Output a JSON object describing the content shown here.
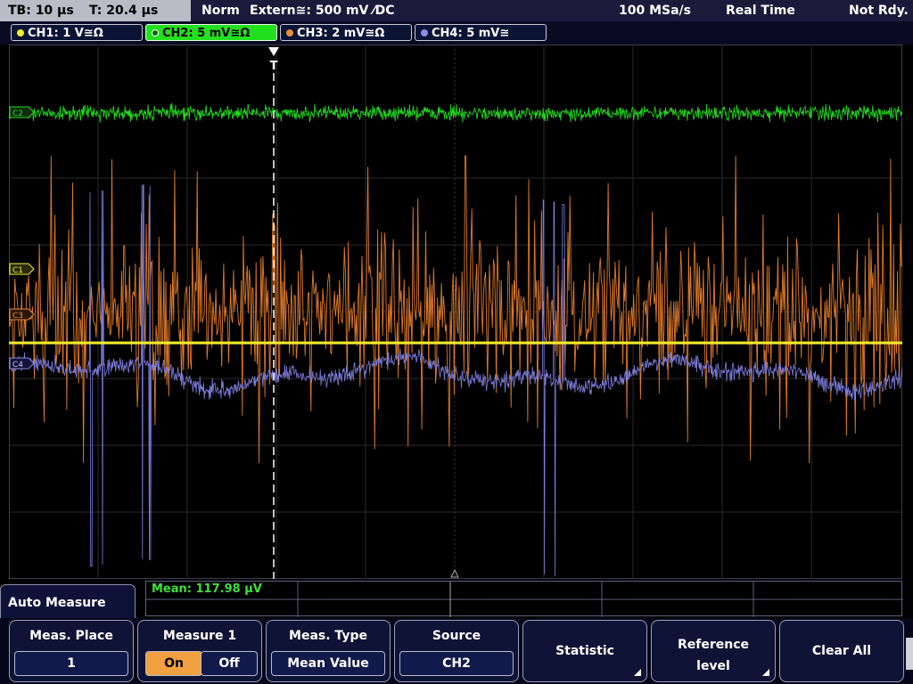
{
  "topbar": {
    "tb": "TB: 10 µs",
    "t": "T: 20.4 µs",
    "mode": "Norm",
    "trigger": "Extern≅: 500 mV ⁄DC",
    "sample_rate": "100 MSa/s",
    "acq_mode": "Real Time",
    "state": "Not Rdy."
  },
  "channels": [
    {
      "label": "CH1: 1 V≅Ω",
      "color": "#f4ee2a"
    },
    {
      "label": "CH2: 5 mV≅Ω",
      "color": "#23e01e"
    },
    {
      "label": "CH3: 2 mV≅Ω",
      "color": "#f08c3a"
    },
    {
      "label": "CH4: 5 mV≅",
      "color": "#8c8ce8"
    }
  ],
  "markers": {
    "c1": "C1",
    "c2": "C2",
    "c3": "C3",
    "c4": "C4",
    "trigger": "T"
  },
  "measurement": {
    "mean": "Mean: 117.98 µV"
  },
  "menu": {
    "title": "Auto Measure",
    "meas_place": {
      "title": "Meas. Place",
      "value": "1"
    },
    "measure1": {
      "title": "Measure 1",
      "on": "On",
      "off": "Off"
    },
    "meas_type": {
      "title": "Meas. Type",
      "value": "Mean Value"
    },
    "source": {
      "title": "Source",
      "value": "CH2"
    },
    "statistic": {
      "title": "Statistic"
    },
    "reference": {
      "line1": "Reference",
      "line2": "level"
    },
    "clear_all": {
      "title": "Clear All"
    }
  }
}
